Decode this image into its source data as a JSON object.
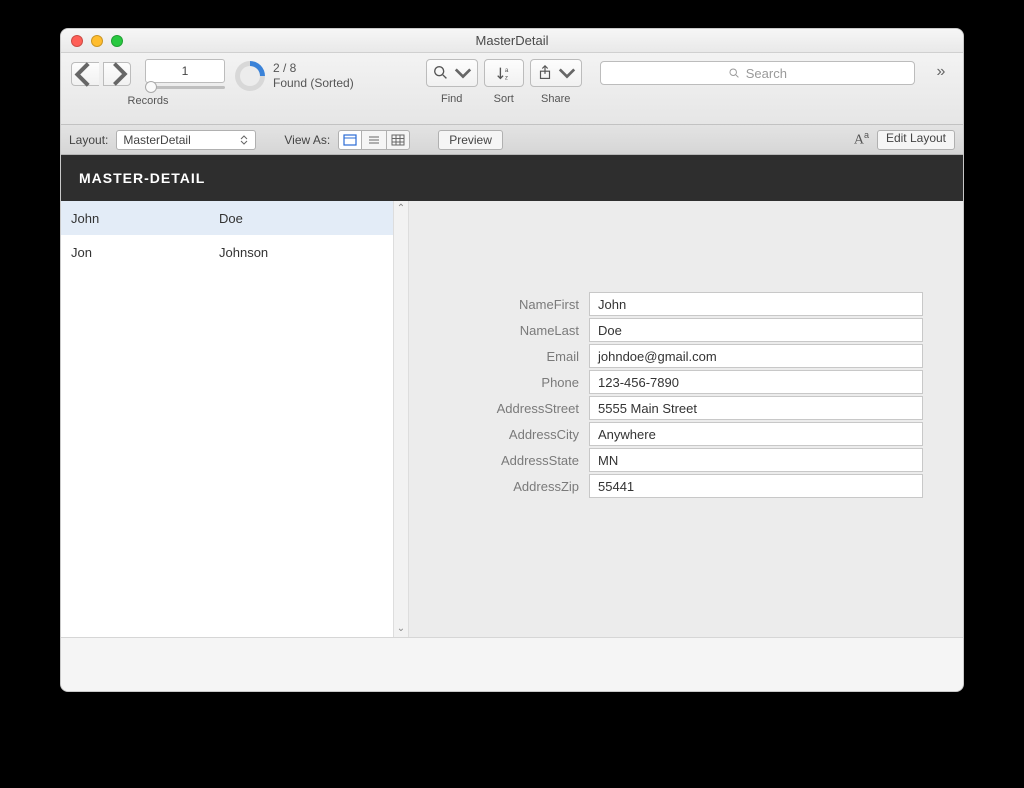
{
  "window": {
    "title": "MasterDetail"
  },
  "toolbar": {
    "record_number": "1",
    "records_label": "Records",
    "found_count": "2 / 8",
    "found_status": "Found (Sorted)",
    "find_label": "Find",
    "sort_label": "Sort",
    "share_label": "Share",
    "search_placeholder": "Search"
  },
  "layoutbar": {
    "layout_label": "Layout:",
    "layout_value": "MasterDetail",
    "viewas_label": "View As:",
    "preview_label": "Preview",
    "edit_layout_label": "Edit Layout"
  },
  "header": {
    "title": "MASTER-DETAIL"
  },
  "master": {
    "rows": [
      {
        "first": "John",
        "last": "Doe",
        "selected": true
      },
      {
        "first": "Jon",
        "last": "Johnson",
        "selected": false
      }
    ]
  },
  "detail": {
    "fields": [
      {
        "label": "NameFirst",
        "value": "John"
      },
      {
        "label": "NameLast",
        "value": "Doe"
      },
      {
        "label": "Email",
        "value": "johndoe@gmail.com"
      },
      {
        "label": "Phone",
        "value": "123-456-7890"
      },
      {
        "label": "AddressStreet",
        "value": "5555 Main Street"
      },
      {
        "label": "AddressCity",
        "value": "Anywhere"
      },
      {
        "label": "AddressState",
        "value": "MN"
      },
      {
        "label": "AddressZip",
        "value": "55441"
      }
    ]
  }
}
